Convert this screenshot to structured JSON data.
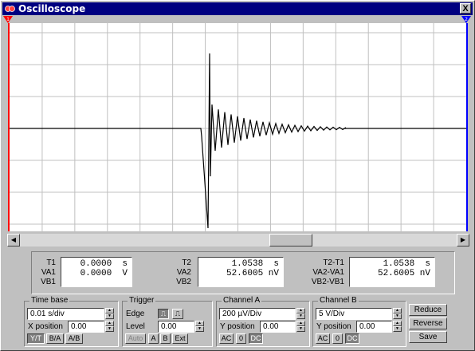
{
  "window": {
    "title": "Oscilloscope",
    "close_glyph": "X"
  },
  "markers": {
    "t1": "1",
    "t2": "2"
  },
  "readout": {
    "t1": {
      "labels": [
        "T1",
        "VA1",
        "VB1"
      ],
      "values": [
        "0.0000  s",
        "0.0000  V",
        ""
      ]
    },
    "t2": {
      "labels": [
        "T2",
        "VA2",
        "VB2"
      ],
      "values": [
        "1.0538  s",
        "52.6005 nV",
        ""
      ]
    },
    "diff": {
      "labels": [
        "T2-T1",
        "VA2-VA1",
        "VB2-VB1"
      ],
      "values": [
        "1.0538  s",
        "52.6005 nV",
        ""
      ]
    }
  },
  "timebase": {
    "title": "Time base",
    "value": "0.01 s/div",
    "xpos_label": "X position",
    "xpos_value": "0.00",
    "modes": [
      "Y/T",
      "B/A",
      "A/B"
    ]
  },
  "trigger": {
    "title": "Trigger",
    "edge_label": "Edge",
    "level_label": "Level",
    "level_value": "0.00",
    "modes": [
      "Auto",
      "A",
      "B",
      "Ext"
    ]
  },
  "channel_a": {
    "title": "Channel A",
    "value": "200 µV/Div",
    "ypos_label": "Y position",
    "ypos_value": "0.00",
    "coupling": [
      "AC",
      "0",
      "DC"
    ]
  },
  "channel_b": {
    "title": "Channel B",
    "value": "5  V/Div",
    "ypos_label": "Y position",
    "ypos_value": "0.00",
    "coupling": [
      "AC",
      "0",
      "DC"
    ]
  },
  "buttons": {
    "reduce": "Reduce",
    "reverse": "Reverse",
    "save": "Save"
  },
  "scrollbar": {
    "position_fraction": 0.63
  },
  "colors": {
    "title_bar": "#000080",
    "marker_t1": "#ff0000",
    "marker_t2": "#0000ff",
    "grid": "#c0c0c0",
    "trace": "#000000"
  }
}
